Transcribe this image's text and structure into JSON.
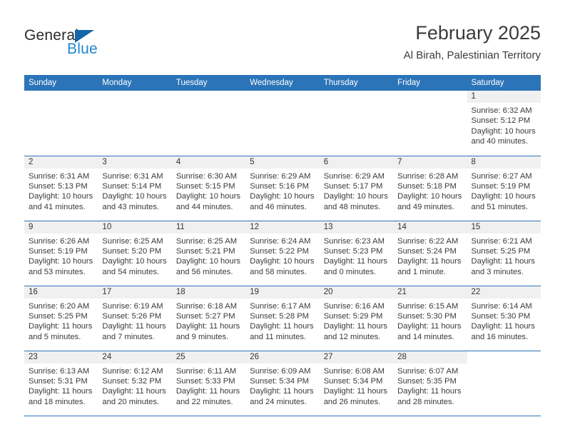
{
  "brand": {
    "name_dark": "General",
    "name_blue": "Blue",
    "accent_color": "#1f86d0",
    "triangle_color": "#1566a8"
  },
  "header": {
    "title": "February 2025",
    "subtitle": "Al Birah, Palestinian Territory"
  },
  "theme": {
    "header_row_bg": "#2b74b8",
    "daynum_bg": "#f0f0f0",
    "grid_line": "#2b74b8",
    "text": "#333333"
  },
  "weekdays": [
    "Sunday",
    "Monday",
    "Tuesday",
    "Wednesday",
    "Thursday",
    "Friday",
    "Saturday"
  ],
  "weeks": [
    [
      {
        "day": "",
        "blank": true,
        "sunrise": "",
        "sunset": "",
        "daylight1": "",
        "daylight2": ""
      },
      {
        "day": "",
        "blank": true,
        "sunrise": "",
        "sunset": "",
        "daylight1": "",
        "daylight2": ""
      },
      {
        "day": "",
        "blank": true,
        "sunrise": "",
        "sunset": "",
        "daylight1": "",
        "daylight2": ""
      },
      {
        "day": "",
        "blank": true,
        "sunrise": "",
        "sunset": "",
        "daylight1": "",
        "daylight2": ""
      },
      {
        "day": "",
        "blank": true,
        "sunrise": "",
        "sunset": "",
        "daylight1": "",
        "daylight2": ""
      },
      {
        "day": "",
        "blank": true,
        "sunrise": "",
        "sunset": "",
        "daylight1": "",
        "daylight2": ""
      },
      {
        "day": "1",
        "sunrise": "Sunrise: 6:32 AM",
        "sunset": "Sunset: 5:12 PM",
        "daylight1": "Daylight: 10 hours",
        "daylight2": "and 40 minutes."
      }
    ],
    [
      {
        "day": "2",
        "sunrise": "Sunrise: 6:31 AM",
        "sunset": "Sunset: 5:13 PM",
        "daylight1": "Daylight: 10 hours",
        "daylight2": "and 41 minutes."
      },
      {
        "day": "3",
        "sunrise": "Sunrise: 6:31 AM",
        "sunset": "Sunset: 5:14 PM",
        "daylight1": "Daylight: 10 hours",
        "daylight2": "and 43 minutes."
      },
      {
        "day": "4",
        "sunrise": "Sunrise: 6:30 AM",
        "sunset": "Sunset: 5:15 PM",
        "daylight1": "Daylight: 10 hours",
        "daylight2": "and 44 minutes."
      },
      {
        "day": "5",
        "sunrise": "Sunrise: 6:29 AM",
        "sunset": "Sunset: 5:16 PM",
        "daylight1": "Daylight: 10 hours",
        "daylight2": "and 46 minutes."
      },
      {
        "day": "6",
        "sunrise": "Sunrise: 6:29 AM",
        "sunset": "Sunset: 5:17 PM",
        "daylight1": "Daylight: 10 hours",
        "daylight2": "and 48 minutes."
      },
      {
        "day": "7",
        "sunrise": "Sunrise: 6:28 AM",
        "sunset": "Sunset: 5:18 PM",
        "daylight1": "Daylight: 10 hours",
        "daylight2": "and 49 minutes."
      },
      {
        "day": "8",
        "sunrise": "Sunrise: 6:27 AM",
        "sunset": "Sunset: 5:19 PM",
        "daylight1": "Daylight: 10 hours",
        "daylight2": "and 51 minutes."
      }
    ],
    [
      {
        "day": "9",
        "sunrise": "Sunrise: 6:26 AM",
        "sunset": "Sunset: 5:19 PM",
        "daylight1": "Daylight: 10 hours",
        "daylight2": "and 53 minutes."
      },
      {
        "day": "10",
        "sunrise": "Sunrise: 6:25 AM",
        "sunset": "Sunset: 5:20 PM",
        "daylight1": "Daylight: 10 hours",
        "daylight2": "and 54 minutes."
      },
      {
        "day": "11",
        "sunrise": "Sunrise: 6:25 AM",
        "sunset": "Sunset: 5:21 PM",
        "daylight1": "Daylight: 10 hours",
        "daylight2": "and 56 minutes."
      },
      {
        "day": "12",
        "sunrise": "Sunrise: 6:24 AM",
        "sunset": "Sunset: 5:22 PM",
        "daylight1": "Daylight: 10 hours",
        "daylight2": "and 58 minutes."
      },
      {
        "day": "13",
        "sunrise": "Sunrise: 6:23 AM",
        "sunset": "Sunset: 5:23 PM",
        "daylight1": "Daylight: 11 hours",
        "daylight2": "and 0 minutes."
      },
      {
        "day": "14",
        "sunrise": "Sunrise: 6:22 AM",
        "sunset": "Sunset: 5:24 PM",
        "daylight1": "Daylight: 11 hours",
        "daylight2": "and 1 minute."
      },
      {
        "day": "15",
        "sunrise": "Sunrise: 6:21 AM",
        "sunset": "Sunset: 5:25 PM",
        "daylight1": "Daylight: 11 hours",
        "daylight2": "and 3 minutes."
      }
    ],
    [
      {
        "day": "16",
        "sunrise": "Sunrise: 6:20 AM",
        "sunset": "Sunset: 5:25 PM",
        "daylight1": "Daylight: 11 hours",
        "daylight2": "and 5 minutes."
      },
      {
        "day": "17",
        "sunrise": "Sunrise: 6:19 AM",
        "sunset": "Sunset: 5:26 PM",
        "daylight1": "Daylight: 11 hours",
        "daylight2": "and 7 minutes."
      },
      {
        "day": "18",
        "sunrise": "Sunrise: 6:18 AM",
        "sunset": "Sunset: 5:27 PM",
        "daylight1": "Daylight: 11 hours",
        "daylight2": "and 9 minutes."
      },
      {
        "day": "19",
        "sunrise": "Sunrise: 6:17 AM",
        "sunset": "Sunset: 5:28 PM",
        "daylight1": "Daylight: 11 hours",
        "daylight2": "and 11 minutes."
      },
      {
        "day": "20",
        "sunrise": "Sunrise: 6:16 AM",
        "sunset": "Sunset: 5:29 PM",
        "daylight1": "Daylight: 11 hours",
        "daylight2": "and 12 minutes."
      },
      {
        "day": "21",
        "sunrise": "Sunrise: 6:15 AM",
        "sunset": "Sunset: 5:30 PM",
        "daylight1": "Daylight: 11 hours",
        "daylight2": "and 14 minutes."
      },
      {
        "day": "22",
        "sunrise": "Sunrise: 6:14 AM",
        "sunset": "Sunset: 5:30 PM",
        "daylight1": "Daylight: 11 hours",
        "daylight2": "and 16 minutes."
      }
    ],
    [
      {
        "day": "23",
        "sunrise": "Sunrise: 6:13 AM",
        "sunset": "Sunset: 5:31 PM",
        "daylight1": "Daylight: 11 hours",
        "daylight2": "and 18 minutes."
      },
      {
        "day": "24",
        "sunrise": "Sunrise: 6:12 AM",
        "sunset": "Sunset: 5:32 PM",
        "daylight1": "Daylight: 11 hours",
        "daylight2": "and 20 minutes."
      },
      {
        "day": "25",
        "sunrise": "Sunrise: 6:11 AM",
        "sunset": "Sunset: 5:33 PM",
        "daylight1": "Daylight: 11 hours",
        "daylight2": "and 22 minutes."
      },
      {
        "day": "26",
        "sunrise": "Sunrise: 6:09 AM",
        "sunset": "Sunset: 5:34 PM",
        "daylight1": "Daylight: 11 hours",
        "daylight2": "and 24 minutes."
      },
      {
        "day": "27",
        "sunrise": "Sunrise: 6:08 AM",
        "sunset": "Sunset: 5:34 PM",
        "daylight1": "Daylight: 11 hours",
        "daylight2": "and 26 minutes."
      },
      {
        "day": "28",
        "sunrise": "Sunrise: 6:07 AM",
        "sunset": "Sunset: 5:35 PM",
        "daylight1": "Daylight: 11 hours",
        "daylight2": "and 28 minutes."
      },
      {
        "day": "",
        "blank": true,
        "sunrise": "",
        "sunset": "",
        "daylight1": "",
        "daylight2": ""
      }
    ]
  ]
}
